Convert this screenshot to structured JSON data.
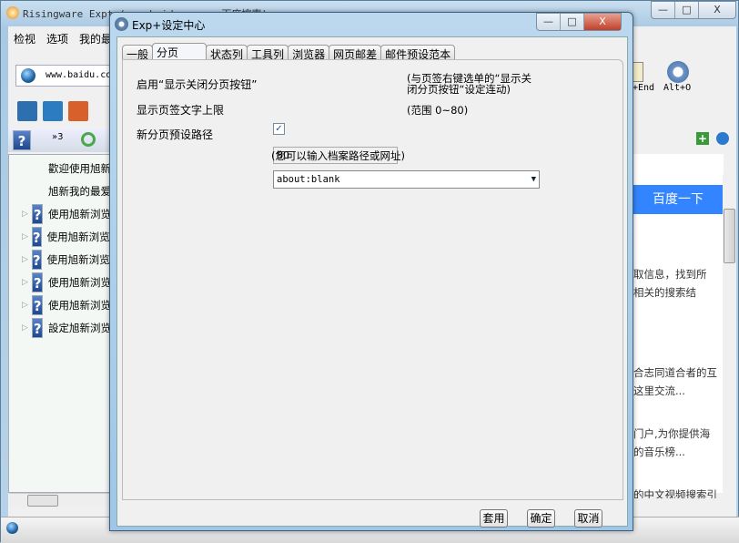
{
  "main_window": {
    "title": "Risingware Expt (www.baidu.com - 百度搜索)",
    "menu": [
      "检视",
      "选项",
      "我的最爱"
    ],
    "address": "www.baidu.com",
    "toolbar_right": [
      "+End",
      "Alt+O"
    ],
    "sidebar_tab_count": "»3",
    "sidebar_items": [
      {
        "label": "歡迎使用旭新",
        "expandable": false
      },
      {
        "label": "旭新我的最爱",
        "expandable": false
      },
      {
        "label": "使用旭新浏览",
        "expandable": true
      },
      {
        "label": "使用旭新浏览器",
        "expandable": true
      },
      {
        "label": "使用旭新浏览器",
        "expandable": true
      },
      {
        "label": "使用旭新浏览",
        "expandable": true
      },
      {
        "label": "使用旭新浏览",
        "expandable": true
      },
      {
        "label": "設定旭新浏览",
        "expandable": true
      }
    ],
    "browser": {
      "search_button": "百度一下",
      "snippets": [
        "取信息，找到所",
        "相关的搜索结",
        "合志同道合者的互",
        "这里交流...",
        "门户,为你提供海",
        "的音乐榜...",
        "的中文视频搜索引"
      ]
    },
    "accent_color": "#3385ff"
  },
  "dialog": {
    "title": "Exp+设定中心",
    "tabs": [
      {
        "label": "一般",
        "active": false
      },
      {
        "label": "分页",
        "active": true
      },
      {
        "label": "状态列",
        "active": false
      },
      {
        "label": "工具列",
        "active": false
      },
      {
        "label": "浏览器",
        "active": false
      },
      {
        "label": "网页邮差",
        "active": false
      },
      {
        "label": "邮件预设范本",
        "active": false
      }
    ],
    "fields": {
      "show_close": {
        "label": "启用“显示关闭分页按钮”",
        "checked": true,
        "hint1": "(与页签右键选单的“显示关",
        "hint2": " 闭分页按钮“设定连动)"
      },
      "max_len": {
        "label": "显示页签文字上限",
        "value": "80",
        "hint": "(范围 0~80)"
      },
      "new_path": {
        "label": "新分页预设路径",
        "value": "about:blank",
        "hint": "(您可以输入档案路径或网址)"
      }
    },
    "buttons": {
      "apply": "套用",
      "ok": "确定",
      "cancel": "取消"
    }
  },
  "window_buttons": {
    "minimize": "—",
    "maximize": "□",
    "close": "X"
  }
}
